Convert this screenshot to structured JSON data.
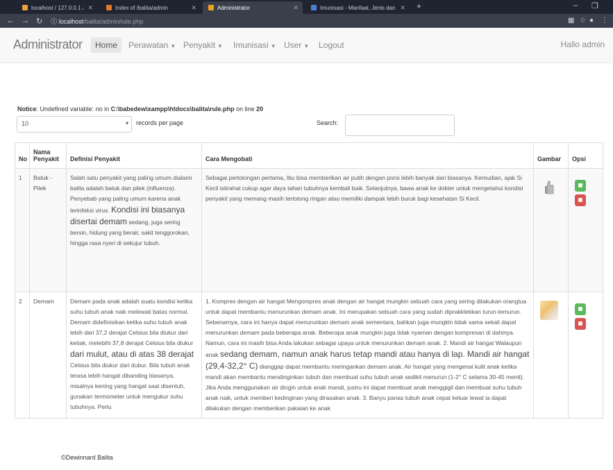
{
  "browser": {
    "tabs": [
      {
        "title": "localhost / 127.0.0.1 / balita / rul",
        "fav": "#e8a33d"
      },
      {
        "title": "Index of /balita/admin",
        "fav": "#e07a2e"
      },
      {
        "title": "Administrator",
        "fav": "#f0a020"
      },
      {
        "title": "Imunisasi - Manfaat, Jenis dan J",
        "fav": "#4a7fd6"
      }
    ],
    "new_tab": "+",
    "url_host": "localhost",
    "url_path": "/balita/admin/rule.php"
  },
  "navbar": {
    "brand": "Administrator",
    "items": [
      {
        "label": "Home",
        "dropdown": false,
        "active": true
      },
      {
        "label": "Perawatan",
        "dropdown": true
      },
      {
        "label": "Penyakit",
        "dropdown": true
      },
      {
        "label": "Imunisasi",
        "dropdown": true
      },
      {
        "label": "User",
        "dropdown": true
      },
      {
        "label": "Logout",
        "dropdown": false
      }
    ],
    "greeting": "Hallo admin"
  },
  "notice": {
    "label": "Notice",
    "message": ": Undefined variable: no in ",
    "path": "C:\\babedew\\xampp\\htdocs\\balita\\rule.php",
    "line_text": " on line ",
    "line_number": "20"
  },
  "table_controls": {
    "length_value": "10",
    "records_per_page": "records per page",
    "search_label": "Search:",
    "search_value": ""
  },
  "table": {
    "headers": [
      "No",
      "Nama Penyakit",
      "Definisi Penyakit",
      "Cara Mengobati",
      "Gambar",
      "Opsi"
    ],
    "rows": [
      {
        "no": "1",
        "nama": "Batuk - Pilek",
        "definisi_pre": "Salah satu penyakit yang paling umum dialami balita adalah batuk dan pilek (influenza). Penyebab yang paling umum karena anak terinfeksi virus.",
        "definisi_big": "Kondisi ini biasanya disertai demam",
        "definisi_post": "sedang, juga sering bersin, hidung yang berair, sakit tenggorokan, hingga rasa nyeri di sekujur tubuh.",
        "cara_pre": "Sebagai pertolongan pertama, Ibu bisa memberikan air putih dengan porsi lebih banyak dari biasanya. Kemudian, ajak Si Kecil istirahat cukup agar daya tahan tubuhnya kembali baik. Selanjutnya, bawa anak ke dokter untuk mengetahui kondisi penyakit yang memang masih tertolong ringan atau memiliki dampak lebih buruk bagi kesehatan Si Kecil.",
        "cara_big": "",
        "cara_post": "",
        "gambar": "thumbs-up-icon"
      },
      {
        "no": "2",
        "nama": "Demam",
        "definisi_pre": "Demam pada anak adalah suatu kondisi ketika suhu tubuh anak naik melewati batas normal. Demam didefinisikan ketika suhu tubuh anak lebih dari 37,2 derajat Celsius bila diukur dari ketiak, melebihi 37,8 derajat Celsius bila diukur",
        "definisi_big": "dari mulut, atau di atas 38 derajat",
        "definisi_post": "Celsius bila diukur dari dubur. Bila tubuh anak terasa lebih hangat dibanding biasanya, misalnya kening yang hangat saat disentuh, gunakan termometer untuk mengukur suhu tubuhnya. Perlu",
        "cara_pre": "1. Kompres dengan air hangat Mengompres anak dengan air hangat mungkin sebuah cara yang sering dilakukan orangtua untuk dapat membantu menurunkan demam anak. Ini merupakan sebuah cara yang sudah diprakktekkan turun-temurun. Sebenarnya, cara ini hanya dapat menurunkan demam anak sementara, bahkan juga mungkin tidak sama sekali dapat menurunkan demam pada beberapa anak. Beberapa anak mungkin juga tidak nyaman dengan kompresan di dahinya. Namun, cara ini masih bisa Anda lakukan sebagai upaya untuk menurunkan demam anak. 2. Mandi air hangat Walaupun anak",
        "cara_big": "sedang demam, namun anak harus tetap mandi atau hanya di lap. Mandi air hangat (29,4-32,2° C)",
        "cara_post": "dianggap dapat membantu meringankan demam anak. Air hangat yang mengenai kulit anak ketika mandi akan membantu mendinginkan tubuh dan membuat suhu tubuh anak sedikit menurun (1-2° C selama 30-45 menit). Jika Anda menggunakan air dingin untuk anak mandi, justru ini dapat membuat anak menggigil dan membuat suhu tubuh anak naik, untuk memberi kedinginan yang dirasakan anak. 3. Banyu panas tubuh anak cepat keluar lewat ia dapat dilakukan dengan memberikan pakaian ke anak",
        "gambar": "food-image"
      }
    ]
  },
  "footer": "©Dewinnard Balita"
}
